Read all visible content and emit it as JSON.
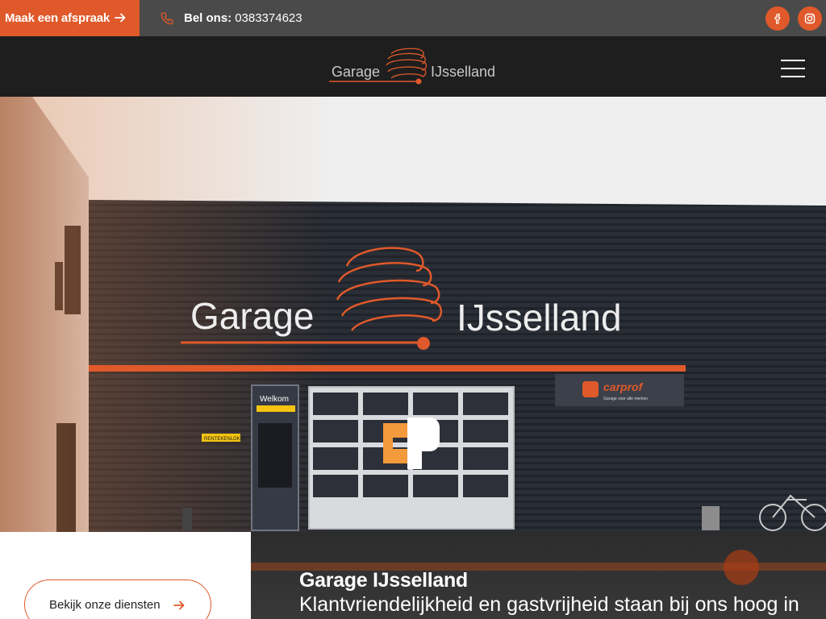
{
  "topbar": {
    "cta_label": "Maak een afspraak",
    "phone_prefix": "Bel ons:",
    "phone_number": "0383374623",
    "social": [
      "facebook-icon",
      "instagram-icon"
    ]
  },
  "header": {
    "logo_left": "Garage",
    "logo_right": "IJsselland",
    "menu_icon": "hamburger-icon"
  },
  "hero": {
    "building_sign_left": "Garage",
    "building_sign_right": "IJsselland",
    "door_sign": "Welkom",
    "counter_sign": "RENTEKENLOKET",
    "brand_sign": "carprof",
    "brand_tagline": "Garage voor alle merken"
  },
  "bottom": {
    "services_button": "Bekijk onze diensten",
    "title": "Garage IJsselland",
    "subtitle": "Klantvriendelijkheid en gastvrijheid staan bij ons hoog in"
  },
  "colors": {
    "accent": "#e0592a",
    "topbar": "#4a4a4a",
    "header": "#1e1e1e"
  }
}
